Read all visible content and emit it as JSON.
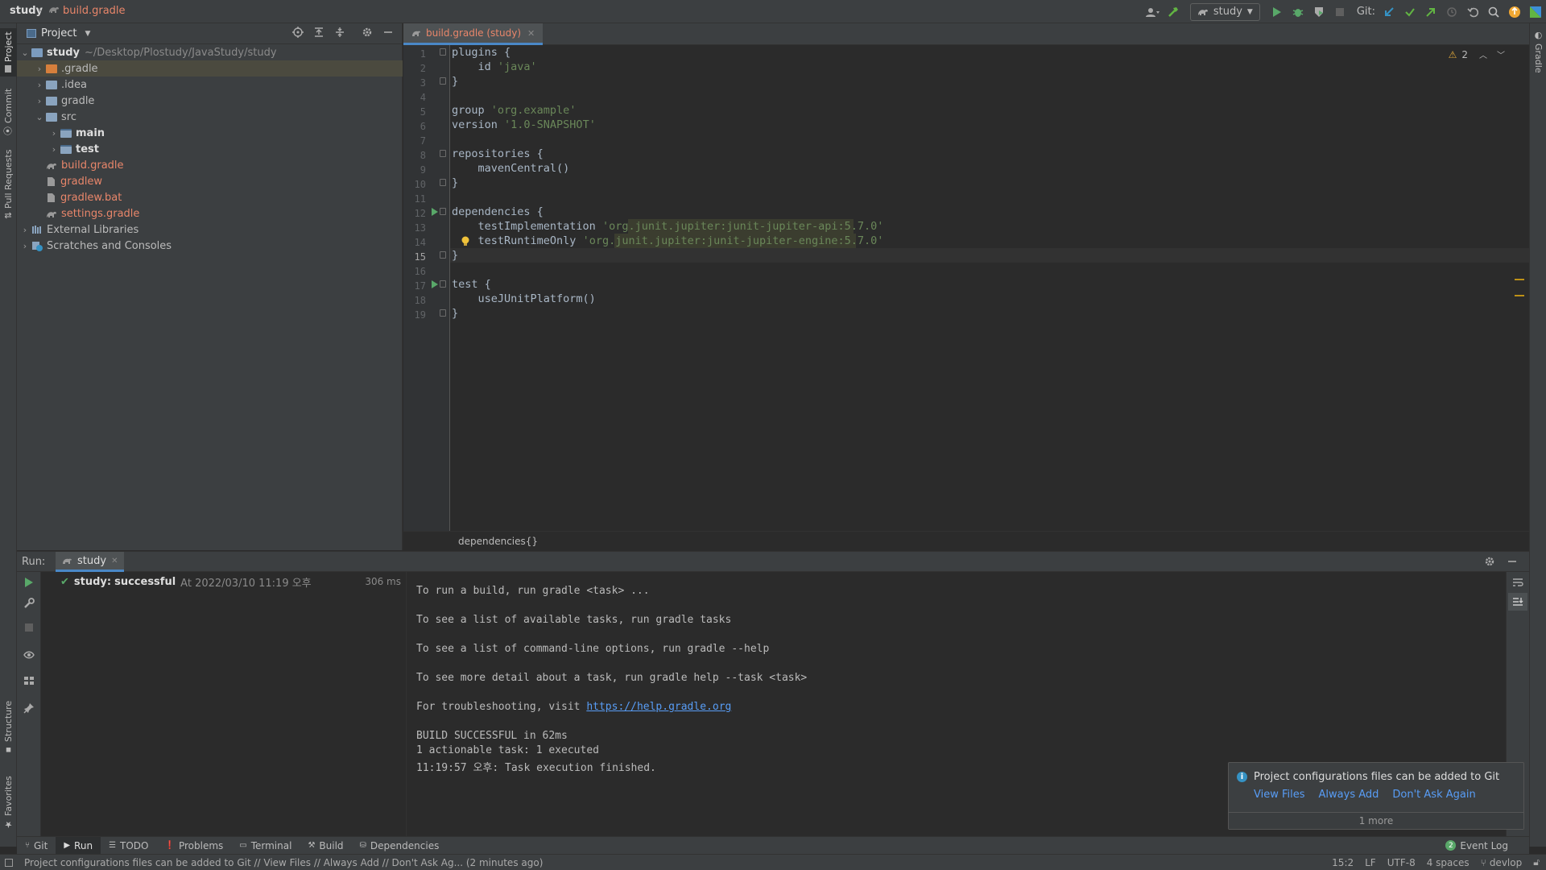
{
  "titlebar": {
    "project": "study",
    "file": "build.gradle",
    "run_config": "study",
    "git_label": "Git:"
  },
  "left_strip": {
    "tabs": [
      "Project",
      "Commit",
      "Pull Requests",
      "Structure",
      "Favorites"
    ]
  },
  "right_strip": {
    "tabs": [
      "Gradle"
    ]
  },
  "project_panel": {
    "title": "Project",
    "root_name": "study",
    "root_path": "~/Desktop/Plostudy/JavaStudy/study",
    "items": [
      {
        "label": ".gradle",
        "depth": 1,
        "type": "folder-orange",
        "arrow": "›",
        "selected": true
      },
      {
        "label": ".idea",
        "depth": 1,
        "type": "folder",
        "arrow": "›"
      },
      {
        "label": "gradle",
        "depth": 1,
        "type": "folder",
        "arrow": "›"
      },
      {
        "label": "src",
        "depth": 1,
        "type": "folder",
        "arrow": "⌄"
      },
      {
        "label": "main",
        "depth": 2,
        "type": "module",
        "arrow": "›",
        "bold": true
      },
      {
        "label": "test",
        "depth": 2,
        "type": "module",
        "arrow": "›",
        "bold": true
      },
      {
        "label": "build.gradle",
        "depth": 1,
        "type": "gradle-file",
        "arrow": "",
        "color": "#e8866a"
      },
      {
        "label": "gradlew",
        "depth": 1,
        "type": "file",
        "arrow": "",
        "color": "#e8866a"
      },
      {
        "label": "gradlew.bat",
        "depth": 1,
        "type": "file",
        "arrow": "",
        "color": "#e8866a"
      },
      {
        "label": "settings.gradle",
        "depth": 1,
        "type": "gradle-file",
        "arrow": "",
        "color": "#e8866a"
      },
      {
        "label": "External Libraries",
        "depth": 0,
        "type": "library",
        "arrow": "›"
      },
      {
        "label": "Scratches and Consoles",
        "depth": 0,
        "type": "scratch",
        "arrow": "›"
      }
    ]
  },
  "editor": {
    "tab_label": "build.gradle (study)",
    "warnings_count": "2",
    "current_line": 15,
    "breadcrumb": "dependencies{}",
    "lines": [
      {
        "n": "1",
        "html": "plugins {"
      },
      {
        "n": "2",
        "html": "    id 'java'"
      },
      {
        "n": "3",
        "html": "}"
      },
      {
        "n": "4",
        "html": ""
      },
      {
        "n": "5",
        "html": "group 'org.example'"
      },
      {
        "n": "6",
        "html": "version '1.0-SNAPSHOT'"
      },
      {
        "n": "7",
        "html": ""
      },
      {
        "n": "8",
        "html": "repositories {"
      },
      {
        "n": "9",
        "html": "    mavenCentral()"
      },
      {
        "n": "10",
        "html": "}"
      },
      {
        "n": "11",
        "html": ""
      },
      {
        "n": "12",
        "html": "dependencies {"
      },
      {
        "n": "13",
        "html": "    testImplementation 'org.junit.jupiter:junit-jupiter-api:5.7.0'"
      },
      {
        "n": "14",
        "html": "    testRuntimeOnly 'org.junit.jupiter:junit-jupiter-engine:5.7.0'"
      },
      {
        "n": "15",
        "html": "}"
      },
      {
        "n": "16",
        "html": ""
      },
      {
        "n": "17",
        "html": "test {"
      },
      {
        "n": "18",
        "html": "    useJUnitPlatform()"
      },
      {
        "n": "19",
        "html": "}"
      }
    ]
  },
  "run_panel": {
    "label": "Run:",
    "tab": "study",
    "result_name": "study:",
    "result_status": "successful",
    "result_time": "At 2022/03/10 11:19 오후",
    "duration": "306 ms",
    "console": [
      "To run a build, run gradle <task> ...",
      "",
      "To see a list of available tasks, run gradle tasks",
      "",
      "To see a list of command-line options, run gradle --help",
      "",
      "To see more detail about a task, run gradle help --task <task>",
      "",
      "For troubleshooting, visit ",
      "",
      "BUILD SUCCESSFUL in 62ms",
      "1 actionable task: 1 executed",
      "11:19:57 오후: Task execution finished."
    ],
    "link": "https://help.gradle.org"
  },
  "notification": {
    "message": "Project configurations files can be added to Git",
    "actions": [
      "View Files",
      "Always Add",
      "Don't Ask Again"
    ],
    "more": "1 more"
  },
  "bottom_tools": [
    {
      "label": "Git",
      "icon": "git-branch-icon"
    },
    {
      "label": "Run",
      "icon": "run-icon",
      "active": true
    },
    {
      "label": "TODO",
      "icon": "list-icon"
    },
    {
      "label": "Problems",
      "icon": "problems-icon"
    },
    {
      "label": "Terminal",
      "icon": "terminal-icon"
    },
    {
      "label": "Build",
      "icon": "hammer-icon"
    },
    {
      "label": "Dependencies",
      "icon": "dependencies-icon"
    }
  ],
  "event_log": {
    "count": "2",
    "label": "Event Log"
  },
  "status": {
    "message": "Project configurations files can be added to Git // View Files // Always Add // Don't Ask Ag... (2 minutes ago)",
    "position": "15:2",
    "line_sep": "LF",
    "encoding": "UTF-8",
    "indent": "4 spaces",
    "branch": "devlop"
  }
}
